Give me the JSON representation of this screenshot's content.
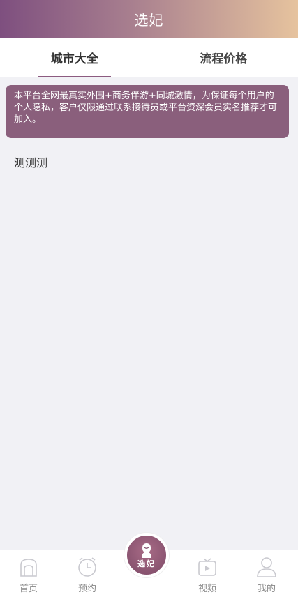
{
  "header": {
    "title": "选妃"
  },
  "tabs": [
    {
      "label": "城市大全",
      "active": true
    },
    {
      "label": "流程价格",
      "active": false
    }
  ],
  "notice": {
    "text": "本平台全网最真实外围+商务伴游+同城激情，为保证每个用户的个人隐私，客户仅限通过联系接待员或平台资深会员实名推荐才可加入。"
  },
  "content": {
    "text": "测测测"
  },
  "tabbar": {
    "items": [
      {
        "label": "首页",
        "icon": "home-icon"
      },
      {
        "label": "预约",
        "icon": "clock-icon"
      },
      {
        "label": "视频",
        "icon": "video-icon"
      },
      {
        "label": "我的",
        "icon": "user-icon"
      }
    ],
    "center": {
      "label": "选妃",
      "icon": "lady-icon"
    }
  },
  "colors": {
    "accent": "#8a5f7c",
    "header_start": "#7e4f7f",
    "header_end": "#e6c39e"
  }
}
